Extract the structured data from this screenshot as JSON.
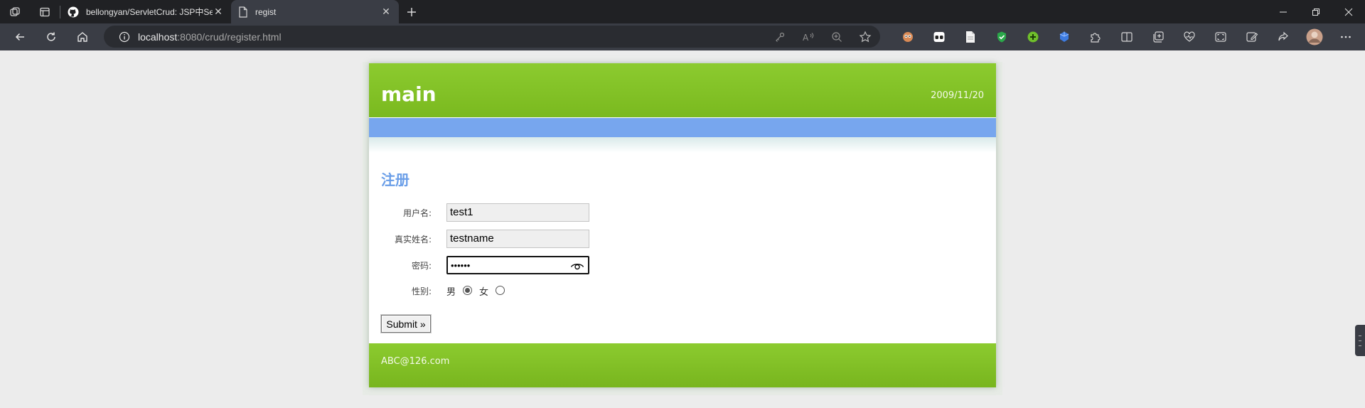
{
  "browser": {
    "tabs": [
      {
        "title": "bellongyan/ServletCrud: JSP中Se",
        "icon": "github-icon",
        "active": false
      },
      {
        "title": "regist",
        "icon": "page-icon",
        "active": true
      }
    ],
    "address": {
      "host": "localhost",
      "path": ":8080/crud/register.html"
    }
  },
  "page": {
    "site_title": "main",
    "date": "2009/11/20",
    "form_title": "注册",
    "fields": {
      "username": {
        "label": "用户名:",
        "value": "test1"
      },
      "realname": {
        "label": "真实姓名:",
        "value": "testname"
      },
      "password": {
        "label": "密码:",
        "value": "••••••"
      },
      "gender": {
        "label": "性别:",
        "option_male": "男",
        "option_female": "女",
        "selected": "男"
      }
    },
    "submit_label": "Submit »",
    "footer_email": "ABC@126.com"
  },
  "colors": {
    "header_green": "#86c42a",
    "nav_blue": "#77a6ee",
    "title_blue": "#6a9ee8"
  }
}
